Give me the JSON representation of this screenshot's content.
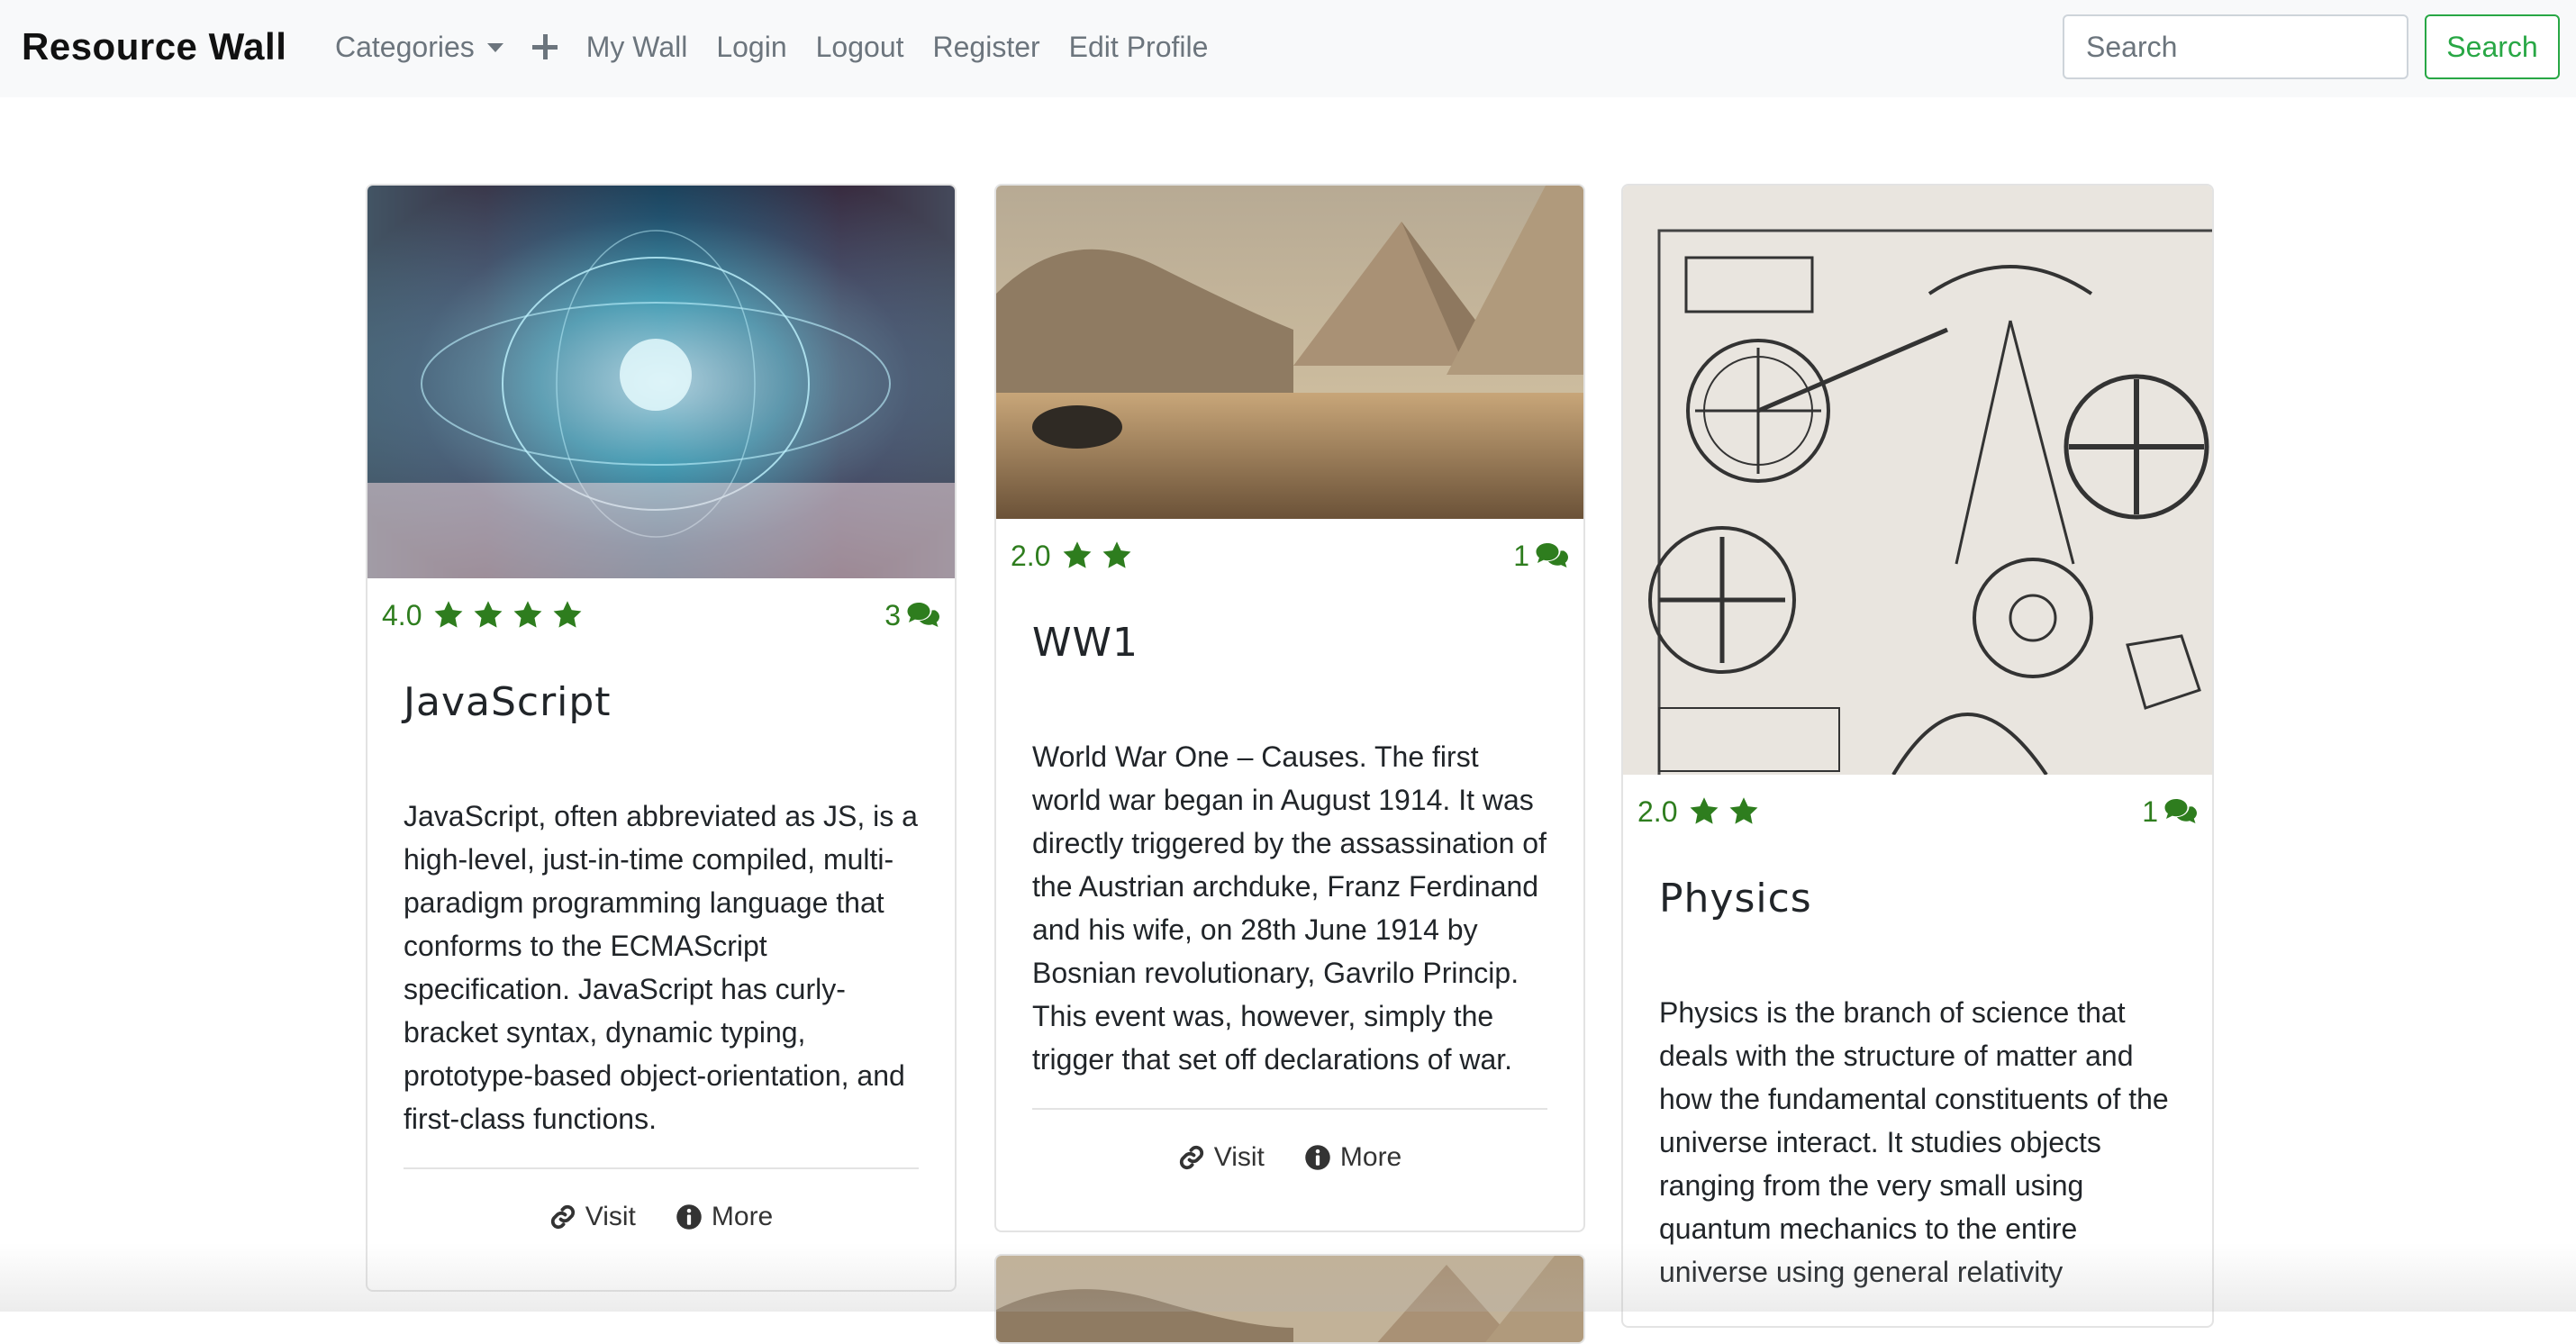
{
  "navbar": {
    "brand": "Resource Wall",
    "categories_label": "Categories",
    "add_icon": "plus-icon",
    "links": [
      "My Wall",
      "Login",
      "Logout",
      "Register",
      "Edit Profile"
    ],
    "search_placeholder": "Search",
    "search_button": "Search"
  },
  "colors": {
    "accent_green": "#28a745",
    "rating_green": "#2e7d1e",
    "nav_bg": "#f8f9fa"
  },
  "cards": [
    {
      "rating": "4.0",
      "stars": 4,
      "comments": "3",
      "title": "JavaScript",
      "text": "JavaScript, often abbreviated as JS, is a high-level, just-in-time compiled, multi-paradigm programming language that conforms to the ECMAScript specification. JavaScript has curly-bracket syntax, dynamic typing, prototype-based object-orientation, and first-class functions.",
      "visit": "Visit",
      "more": "More"
    },
    {
      "rating": "2.0",
      "stars": 2,
      "comments": "1",
      "title": "WW1",
      "text": "World War One – Causes. The first world war began in August 1914. It was directly triggered by the assassination of the Austrian archduke, Franz Ferdinand and his wife, on 28th June 1914 by Bosnian revolutionary, Gavrilo Princip. This event was, however, simply the trigger that set off declarations of war.",
      "visit": "Visit",
      "more": "More"
    },
    {
      "rating": "2.0",
      "stars": 2,
      "comments": "1",
      "title": "Physics",
      "text": "Physics is the branch of science that deals with the structure of matter and how the fundamental constituents of the universe interact. It studies objects ranging from the very small using quantum mechanics to the entire universe using general relativity"
    }
  ]
}
